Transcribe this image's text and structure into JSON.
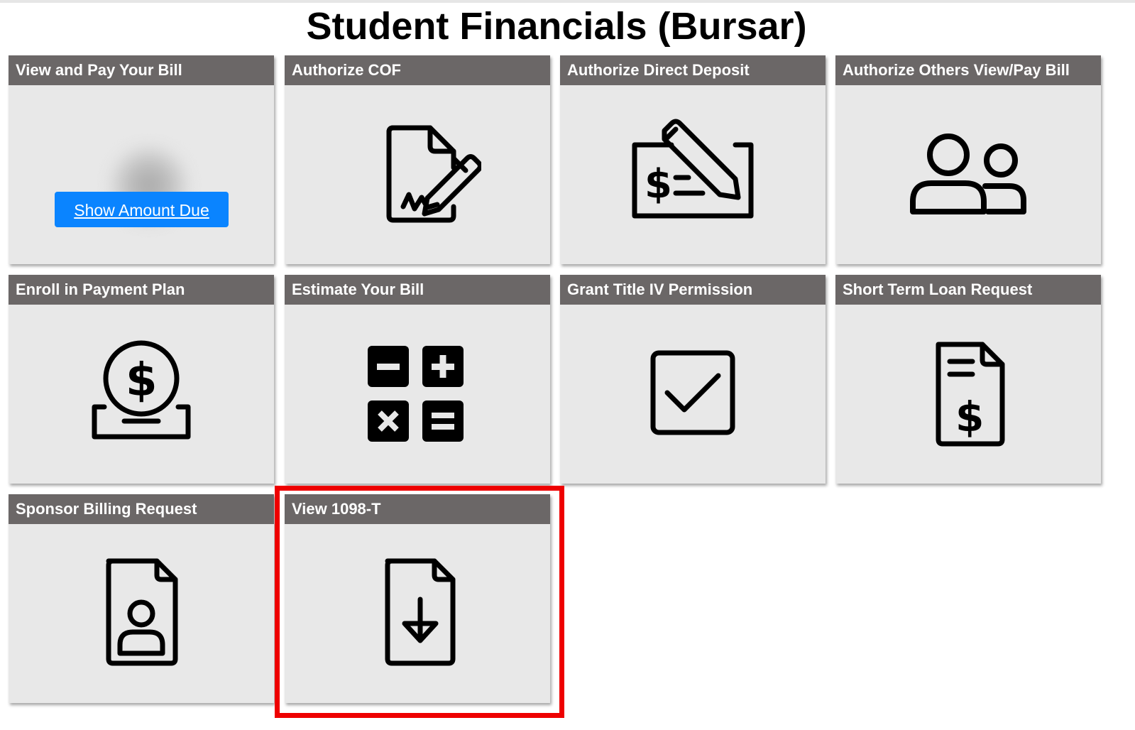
{
  "page": {
    "title": "Student Financials (Bursar)"
  },
  "tiles": [
    {
      "label": "View and Pay Your Bill",
      "icon": "blurred-amount",
      "button_label": "Show Amount Due"
    },
    {
      "label": "Authorize COF",
      "icon": "document-signature-icon"
    },
    {
      "label": "Authorize Direct Deposit",
      "icon": "check-pencil-icon"
    },
    {
      "label": "Authorize Others View/Pay Bill",
      "icon": "users-icon"
    },
    {
      "label": "Enroll in Payment Plan",
      "icon": "coin-deposit-icon"
    },
    {
      "label": "Estimate Your Bill",
      "icon": "calculator-icon"
    },
    {
      "label": "Grant Title IV Permission",
      "icon": "checkbox-icon"
    },
    {
      "label": "Short Term Loan Request",
      "icon": "invoice-dollar-icon"
    },
    {
      "label": "Sponsor Billing Request",
      "icon": "document-user-icon"
    },
    {
      "label": "View 1098-T",
      "icon": "document-download-icon"
    }
  ],
  "colors": {
    "tile_header": "#6b6767",
    "tile_body": "#e8e8e8",
    "button": "#0a84ff",
    "highlight": "#ee0000"
  }
}
